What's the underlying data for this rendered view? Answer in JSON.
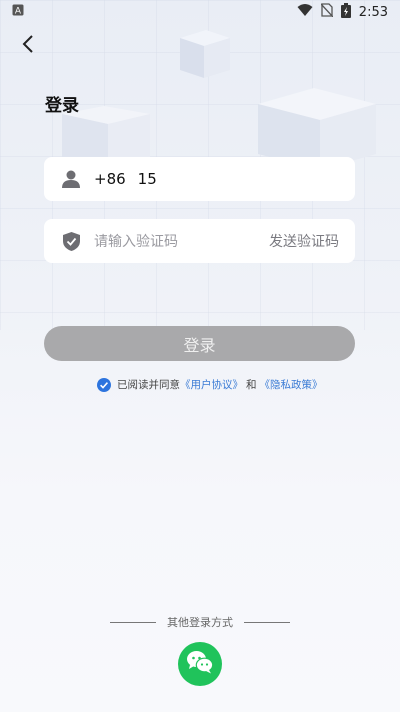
{
  "status_bar": {
    "time": "2:53",
    "app_icon": "a-letter-icon"
  },
  "page": {
    "title": "登录"
  },
  "phone_field": {
    "country_code": "+86",
    "value": "15"
  },
  "code_field": {
    "placeholder": "请输入验证码",
    "send_label": "发送验证码"
  },
  "login_button": {
    "label": "登录"
  },
  "agreement": {
    "prefix": "已阅读并同意",
    "user_agreement": "《用户协议》",
    "and": "和",
    "privacy_policy": "《隐私政策》",
    "checked": true
  },
  "other_login": {
    "label": "其他登录方式",
    "wechat": "wechat-icon"
  },
  "colors": {
    "accent_blue": "#3a7bd5",
    "wechat_green": "#20c35b",
    "button_gray": "#a9a9ab"
  }
}
